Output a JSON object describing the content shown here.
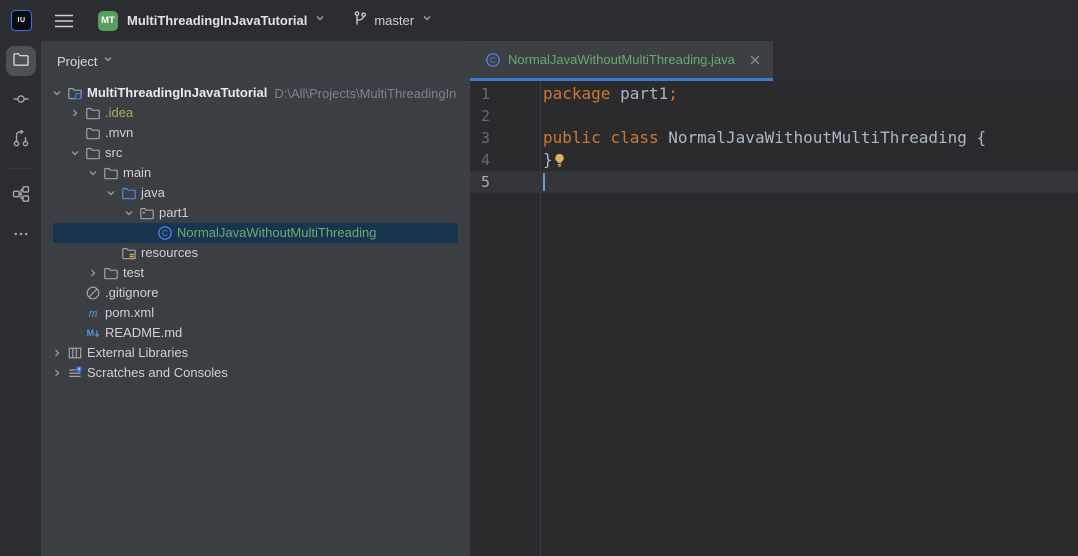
{
  "topbar": {
    "app_icon_label": "IU",
    "project": {
      "avatar_text": "MT",
      "name": "MultiThreadingInJavaTutorial"
    },
    "vcs": {
      "branch": "master"
    }
  },
  "tool_strip": {
    "buttons": [
      {
        "name": "project",
        "icon": "folder-icon",
        "active": true
      },
      {
        "name": "commit",
        "icon": "commit-icon",
        "active": false
      },
      {
        "name": "pull-requests",
        "icon": "pull-request-icon",
        "active": false
      },
      {
        "name": "structure",
        "icon": "structure-icon",
        "active": false,
        "divider_before": true
      },
      {
        "name": "more-tool-windows",
        "icon": "ellipsis-icon",
        "active": false
      }
    ]
  },
  "project_panel": {
    "header_label": "Project",
    "rows": [
      {
        "depth": 0,
        "chevron": "down",
        "icon": "project-folder",
        "label": "MultiThreadingInJavaTutorial",
        "bold": true,
        "suffix": "D:\\All\\Projects\\MultiThreadingIn"
      },
      {
        "depth": 1,
        "chevron": "right",
        "icon": "folder",
        "label": ".idea",
        "color": "ignored"
      },
      {
        "depth": 1,
        "chevron": "none",
        "icon": "folder",
        "label": ".mvn"
      },
      {
        "depth": 1,
        "chevron": "down",
        "icon": "folder",
        "label": "src"
      },
      {
        "depth": 2,
        "chevron": "down",
        "icon": "folder",
        "label": "main"
      },
      {
        "depth": 3,
        "chevron": "down",
        "icon": "folder-source",
        "label": "java"
      },
      {
        "depth": 4,
        "chevron": "down",
        "icon": "package",
        "label": "part1"
      },
      {
        "depth": 5,
        "chevron": "none",
        "icon": "class",
        "label": "NormalJavaWithoutMultiThreading",
        "color": "added",
        "selected": true
      },
      {
        "depth": 3,
        "chevron": "none",
        "icon": "folder-resources",
        "label": "resources"
      },
      {
        "depth": 2,
        "chevron": "right",
        "icon": "folder",
        "label": "test"
      },
      {
        "depth": 1,
        "chevron": "none",
        "icon": "ignored",
        "label": ".gitignore"
      },
      {
        "depth": 1,
        "chevron": "none",
        "icon": "maven",
        "label": "pom.xml"
      },
      {
        "depth": 1,
        "chevron": "none",
        "icon": "markdown",
        "label": "README.md"
      },
      {
        "depth": 0,
        "chevron": "right",
        "icon": "library",
        "label": "External Libraries"
      },
      {
        "depth": 0,
        "chevron": "right",
        "icon": "scratches",
        "label": "Scratches and Consoles"
      }
    ]
  },
  "editor": {
    "tab": {
      "icon": "class-icon",
      "title": "NormalJavaWithoutMultiThreading.java"
    },
    "caret": {
      "line": 5,
      "column": 1
    },
    "current_line": 5,
    "lines": [
      {
        "num": "1",
        "tokens": [
          {
            "text": "package",
            "style": "keyword"
          },
          {
            "text": " ",
            "style": "plain"
          },
          {
            "text": "part1",
            "style": "plain"
          },
          {
            "text": ";",
            "style": "keyword"
          }
        ]
      },
      {
        "num": "2",
        "tokens": []
      },
      {
        "num": "3",
        "tokens": [
          {
            "text": "public",
            "style": "keyword"
          },
          {
            "text": " ",
            "style": "plain"
          },
          {
            "text": "class",
            "style": "keyword"
          },
          {
            "text": " NormalJavaWithoutMultiThreading {",
            "style": "plain"
          }
        ]
      },
      {
        "num": "4",
        "tokens": [
          {
            "text": "}",
            "style": "plain"
          }
        ],
        "bulb": true
      },
      {
        "num": "5",
        "tokens": []
      }
    ]
  },
  "colors": {
    "accent_blue": "#3574F0",
    "tab_underline": "#3E7BCB",
    "vcs_added_green": "#6AAC6E",
    "ignored_olive": "#A9AF4E",
    "keyword_orange": "#CC7832",
    "identifier_gray": "#A9B7C6",
    "selection_navy": "#18344E",
    "panel_bg": "#3B3E43",
    "editor_bg": "#2B2B2D",
    "shell_bg": "#2B2D30",
    "avatar_green": "#57A05C"
  }
}
